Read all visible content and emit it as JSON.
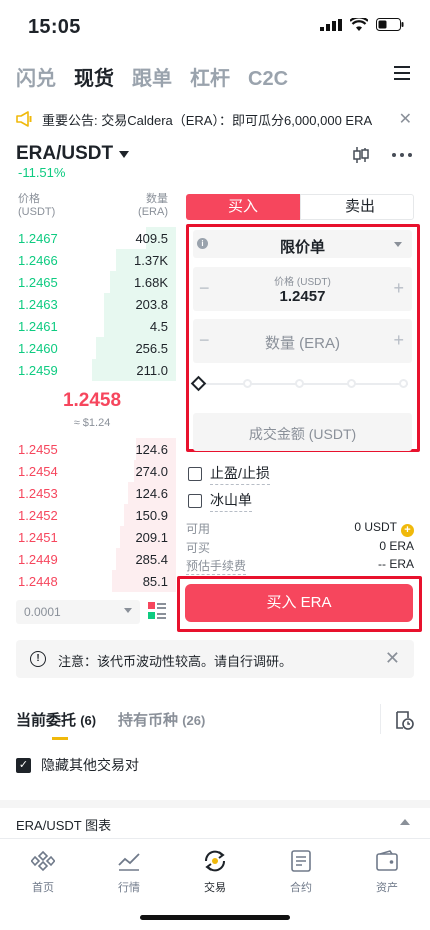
{
  "status": {
    "time": "15:05"
  },
  "topnav": [
    "闪兑",
    "现货",
    "跟单",
    "杠杆",
    "C2C"
  ],
  "announcement": {
    "text": "重要公告: 交易Caldera（ERA）：即可瓜分6,000,000 ERA..."
  },
  "pair": {
    "symbol": "ERA/USDT",
    "change": "-11.51%"
  },
  "orderbook": {
    "price_header": "价格",
    "price_unit": "(USDT)",
    "qty_header": "数量",
    "qty_unit": "(ERA)",
    "bids": [
      {
        "price": "1.2467",
        "qty": "409.5"
      },
      {
        "price": "1.2466",
        "qty": "1.37K"
      },
      {
        "price": "1.2465",
        "qty": "1.68K"
      },
      {
        "price": "1.2463",
        "qty": "203.8"
      },
      {
        "price": "1.2461",
        "qty": "4.5"
      },
      {
        "price": "1.2460",
        "qty": "256.5"
      },
      {
        "price": "1.2459",
        "qty": "211.0"
      }
    ],
    "mid_price": "1.2458",
    "mid_usd": "≈ $1.24",
    "asks": [
      {
        "price": "1.2455",
        "qty": "124.6"
      },
      {
        "price": "1.2454",
        "qty": "274.0"
      },
      {
        "price": "1.2453",
        "qty": "124.6"
      },
      {
        "price": "1.2452",
        "qty": "150.9"
      },
      {
        "price": "1.2451",
        "qty": "209.1"
      },
      {
        "price": "1.2449",
        "qty": "285.4"
      },
      {
        "price": "1.2448",
        "qty": "85.1"
      }
    ],
    "depth": "0.0001"
  },
  "trade": {
    "buy_tab": "买入",
    "sell_tab": "卖出",
    "order_type": "限价单",
    "price_caption": "价格 (USDT)",
    "price_value": "1.2457",
    "qty_placeholder": "数量 (ERA)",
    "total_placeholder": "成交金额 (USDT)",
    "tp_sl": "止盈/止损",
    "iceberg": "冰山单",
    "available_label": "可用",
    "available_value": "0 USDT",
    "can_buy_label": "可买",
    "can_buy_value": "0 ERA",
    "fee_label": "预估手续费",
    "fee_value": "-- ERA",
    "buy_button": "买入 ERA"
  },
  "notice": {
    "text": "注意：该代币波动性较高。请自行调研。"
  },
  "orders": {
    "tab_open": "当前委托",
    "tab_open_count": "(6)",
    "tab_holdings": "持有币种",
    "tab_holdings_count": "(26)",
    "hide_other": "隐藏其他交易对",
    "chart_label": "ERA/USDT 图表"
  },
  "bottomnav": [
    "首页",
    "行情",
    "交易",
    "合约",
    "资产"
  ],
  "colors": {
    "buy": "#0ecb81",
    "sell": "#f6465d",
    "accent": "#f0b90b",
    "highlight": "#e8112d"
  }
}
